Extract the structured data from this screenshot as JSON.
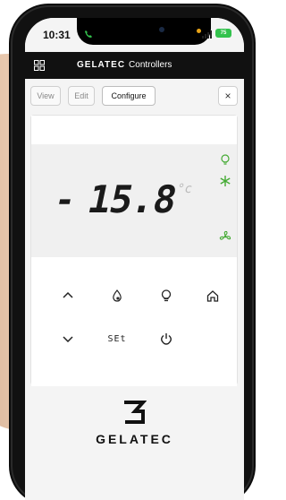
{
  "status_bar": {
    "time": "10:31",
    "battery": "75"
  },
  "app": {
    "brand": "GELATEC",
    "subtitle": "Controllers"
  },
  "toolbar": {
    "view_label": "View",
    "edit_label": "Edit",
    "configure_label": "Configure",
    "close_label": "×"
  },
  "display": {
    "sign": "-",
    "value": "15.8",
    "unit": "°c"
  },
  "keypad": {
    "set_label": "SEt"
  },
  "footer": {
    "logo_text": "GELATEC"
  },
  "colors": {
    "indicator": "#44aa33",
    "header": "#111111"
  }
}
